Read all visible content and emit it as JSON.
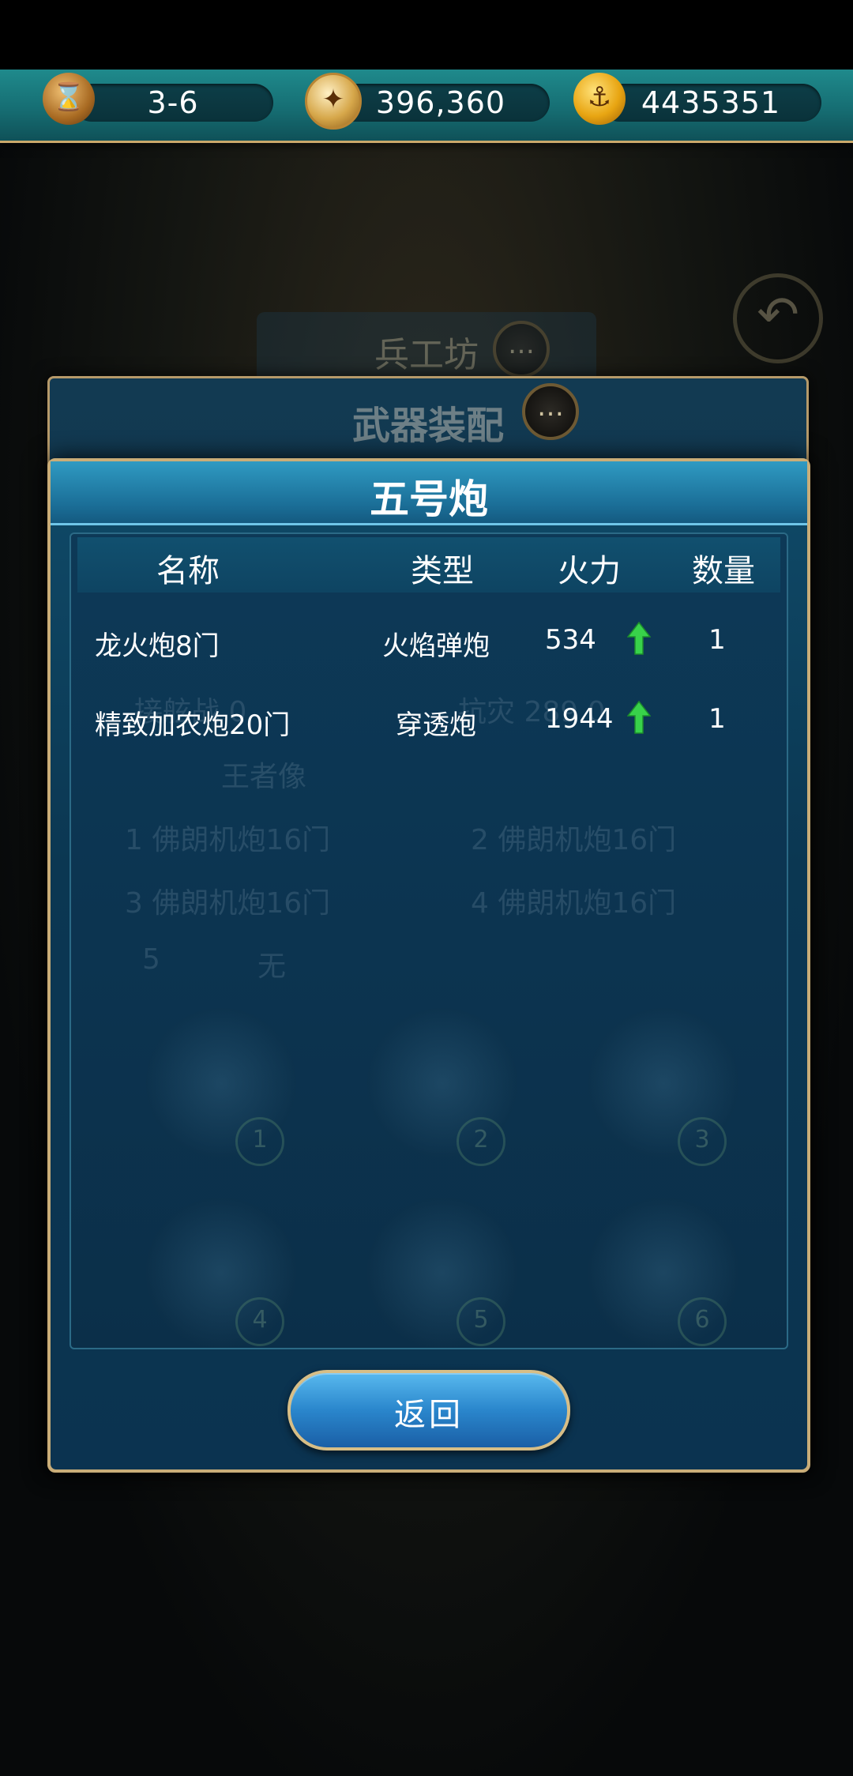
{
  "topbar": {
    "stage": "3-6",
    "compass_value": "396,360",
    "anchor_value": "4435351"
  },
  "background": {
    "workshop_title": "兵工坊",
    "outer_panel_title": "武器装配",
    "ghost": {
      "slot_title": "王者像",
      "slot_1": "1   佛朗机炮16门",
      "slot_2": "2   佛朗机炮16门",
      "slot_3": "3   佛朗机炮16门",
      "slot_4": "4   佛朗机炮16门",
      "slot_5": "5",
      "slot_5_value": "无",
      "stat_left": "接舷战 0",
      "stat_right": "抗灾 289.0",
      "ships": [
        "1",
        "2",
        "3",
        "4",
        "5",
        "6"
      ]
    }
  },
  "modal": {
    "title": "五号炮",
    "columns": [
      "名称",
      "类型",
      "火力",
      "数量"
    ],
    "rows": [
      {
        "name": "龙火炮8门",
        "type": "火焰弹炮",
        "firepower": "534",
        "quantity": "1"
      },
      {
        "name": "精致加农炮20门",
        "type": "穿透炮",
        "firepower": "1944",
        "quantity": "1"
      }
    ],
    "back_label": "返回"
  },
  "colors": {
    "accent_gold": "#c9ad78",
    "teal_bar": "#1f8a8c",
    "arrow_green": "#38d24a"
  }
}
